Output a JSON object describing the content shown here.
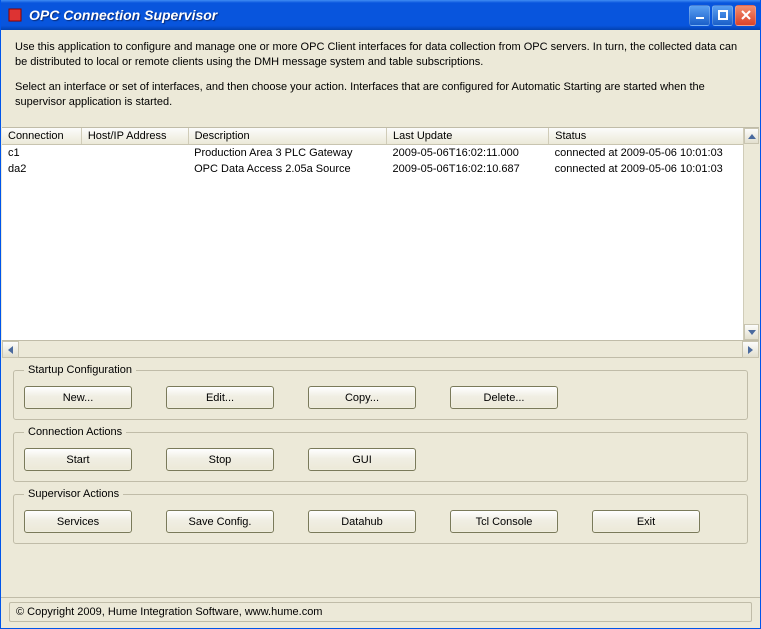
{
  "window": {
    "title": "OPC Connection Supervisor"
  },
  "intro": {
    "p1": "Use this application to configure and manage one or more OPC Client interfaces for data collection from OPC servers.  In turn, the collected data can be distributed to local or remote clients using the DMH message system and table subscriptions.",
    "p2": "Select an interface or set of interfaces, and then choose your action.  Interfaces that are configured for Automatic Starting are started when the supervisor application is started."
  },
  "table": {
    "headers": {
      "connection": "Connection",
      "host": "Host/IP Address",
      "description": "Description",
      "last_update": "Last Update",
      "status": "Status"
    },
    "rows": [
      {
        "connection": "c1",
        "host": "",
        "description": "Production Area 3 PLC Gateway",
        "last_update": "2009-05-06T16:02:11.000",
        "status": "connected at 2009-05-06 10:01:03"
      },
      {
        "connection": "da2",
        "host": "",
        "description": "OPC Data Access 2.05a Source",
        "last_update": "2009-05-06T16:02:10.687",
        "status": "connected at 2009-05-06 10:01:03"
      }
    ]
  },
  "groups": {
    "startup": {
      "legend": "Startup Configuration",
      "new": "New...",
      "edit": "Edit...",
      "copy": "Copy...",
      "delete": "Delete..."
    },
    "connection": {
      "legend": "Connection Actions",
      "start": "Start",
      "stop": "Stop",
      "gui": "GUI"
    },
    "supervisor": {
      "legend": "Supervisor Actions",
      "services": "Services",
      "save": "Save Config.",
      "datahub": "Datahub",
      "tcl": "Tcl Console",
      "exit": "Exit"
    }
  },
  "statusbar": {
    "copyright": "© Copyright 2009, Hume Integration Software, www.hume.com"
  }
}
